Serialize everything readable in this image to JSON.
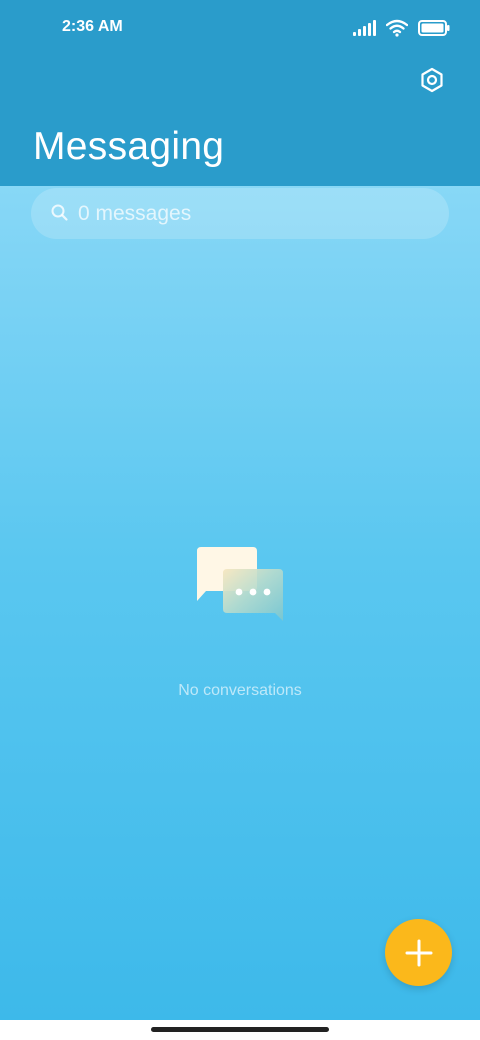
{
  "status_bar": {
    "time": "2:36 AM",
    "signal_icon": "cellular-signal-icon",
    "wifi_icon": "wifi-icon",
    "battery_icon": "battery-full-icon"
  },
  "header": {
    "title": "Messaging",
    "settings_icon": "settings-gear-icon"
  },
  "search": {
    "placeholder": "0 messages",
    "icon": "search-icon"
  },
  "empty_state": {
    "icon": "chat-bubbles-icon",
    "text": "No conversations"
  },
  "fab": {
    "icon": "plus-icon"
  },
  "colors": {
    "header": "#2a9ccb",
    "gradient_top": "#9fe2fb",
    "gradient_bottom": "#3db9ea",
    "fab": "#fbb81b"
  }
}
